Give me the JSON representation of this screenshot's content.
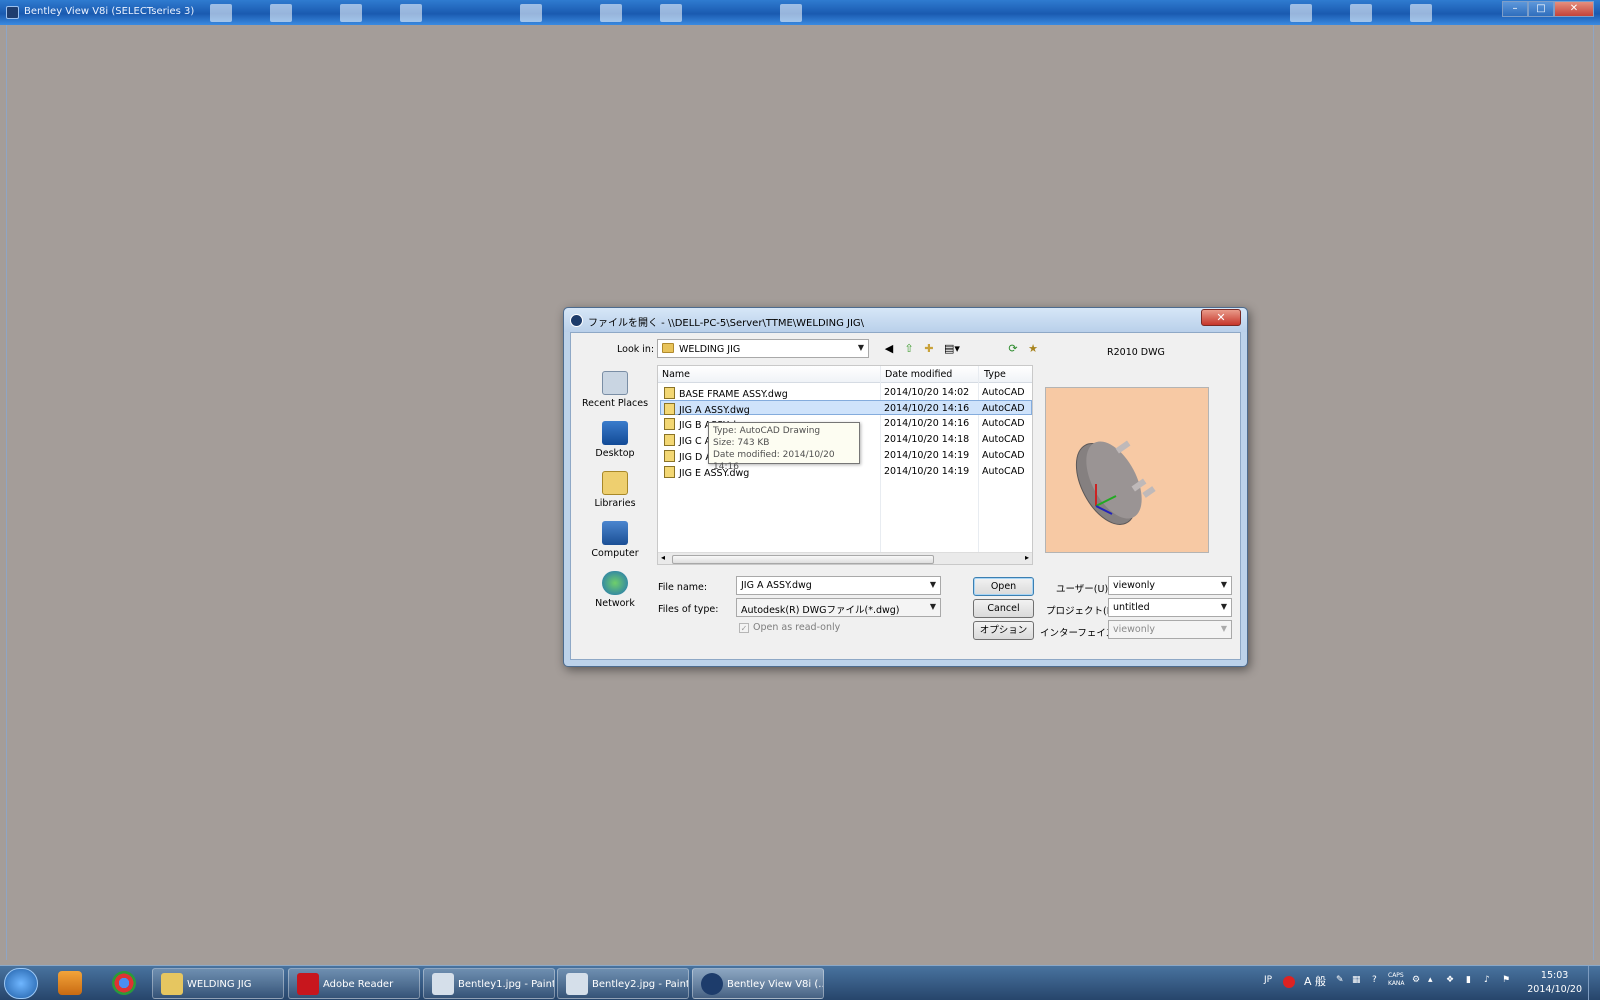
{
  "app": {
    "title": "Bentley View V8i (SELECTseries 3)"
  },
  "dialog": {
    "title": "ファイルを開く - \\\\DELL-PC-5\\Server\\TTME\\WELDING JIG\\",
    "look_in_label": "Look in:",
    "look_in_value": "WELDING JIG",
    "places": [
      "Recent Places",
      "Desktop",
      "Libraries",
      "Computer",
      "Network"
    ],
    "columns": [
      "Name",
      "Date modified",
      "Type"
    ],
    "files": [
      {
        "name": "BASE FRAME ASSY.dwg",
        "date": "2014/10/20 14:02",
        "type": "AutoCAD"
      },
      {
        "name": "JIG A ASSY.dwg",
        "date": "2014/10/20 14:16",
        "type": "AutoCAD"
      },
      {
        "name": "JIG B ASSY.dwg",
        "date": "2014/10/20 14:16",
        "type": "AutoCAD"
      },
      {
        "name": "JIG C ASSY.dwg",
        "date": "2014/10/20 14:18",
        "type": "AutoCAD"
      },
      {
        "name": "JIG D ASSY.dwg",
        "date": "2014/10/20 14:19",
        "type": "AutoCAD"
      },
      {
        "name": "JIG E ASSY.dwg",
        "date": "2014/10/20 14:19",
        "type": "AutoCAD"
      }
    ],
    "tooltip": {
      "type": "Type: AutoCAD Drawing",
      "size": "Size: 743 KB",
      "date": "Date modified: 2014/10/20 14:16"
    },
    "file_name_label": "File name:",
    "file_name_value": "JIG A ASSY.dwg",
    "file_type_label": "Files of type:",
    "file_type_value": "Autodesk(R) DWGファイル(*.dwg)",
    "read_only_label": "Open as read-only",
    "open_button": "Open",
    "cancel_button": "Cancel",
    "options_button": "オプション",
    "preview_label": "R2010 DWG",
    "user_label": "ユーザー(U):",
    "user_value": "viewonly",
    "project_label": "プロジェクト(P):",
    "project_value": "untitled",
    "interface_label": "インターフェイス:",
    "interface_value": "viewonly"
  },
  "taskbar": {
    "tasks": [
      "WELDING JIG",
      "Adobe Reader",
      "Bentley1.jpg - Paint",
      "Bentley2.jpg - Paint",
      "Bentley View V8i (..."
    ],
    "lang": "JP",
    "ime": "A 般",
    "caps": "CAPS",
    "kana": "KANA",
    "time": "15:03",
    "date": "2014/10/20"
  },
  "colors": {
    "accent": "#2f7bd0",
    "desktop": "#a49d99",
    "preview_bg": "#f7c9a4"
  },
  "icons": [
    "app-icon",
    "folder-icon",
    "back-icon",
    "up-folder-icon",
    "new-folder-icon",
    "view-menu-icon",
    "refresh-icon",
    "bookmark-icon",
    "close-icon"
  ]
}
